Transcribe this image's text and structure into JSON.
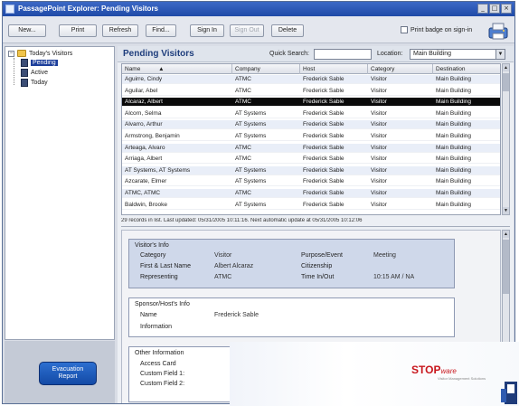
{
  "window": {
    "title": "PassagePoint Explorer: Pending Visitors",
    "controls": [
      "_",
      "□",
      "×"
    ]
  },
  "toolbar": {
    "buttons": [
      "New...",
      "Print",
      "Refresh",
      "Find...",
      "Sign In",
      "Sign Out",
      "Delete"
    ],
    "disabled_index": 5,
    "checkbox_label": "Print badge on sign-in"
  },
  "tree": {
    "root": "Today's Visitors",
    "items": [
      "Pending",
      "Active",
      "Today"
    ],
    "selected": "Pending"
  },
  "evacuation": {
    "line1": "Evacuation",
    "line2": "Report"
  },
  "grid": {
    "title": "Pending Visitors",
    "quick_search_label": "Quick Search:",
    "quick_search_value": "",
    "location_label": "Location:",
    "location_value": "Main Building",
    "columns": [
      "Name",
      "Company",
      "Host",
      "Category",
      "Destination"
    ],
    "sort_indicator": "▲",
    "rows": [
      [
        "Aguirre, Cindy",
        "ATMC",
        "Frederick Sable",
        "Visitor",
        "Main Building"
      ],
      [
        "Aguilar, Abel",
        "ATMC",
        "Frederick Sable",
        "Visitor",
        "Main Building"
      ],
      [
        "Alcaraz, Albert",
        "ATMC",
        "Frederick Sable",
        "Visitor",
        "Main Building"
      ],
      [
        "Alcorn, Selma",
        "AT Systems",
        "Frederick Sable",
        "Visitor",
        "Main Building"
      ],
      [
        "Alvarro, Arthur",
        "AT Systems",
        "Frederick Sable",
        "Visitor",
        "Main Building"
      ],
      [
        "Armstrong, Benjamin",
        "AT Systems",
        "Frederick Sable",
        "Visitor",
        "Main Building"
      ],
      [
        "Arteaga, Alvaro",
        "ATMC",
        "Frederick Sable",
        "Visitor",
        "Main Building"
      ],
      [
        "Arriaga, Albert",
        "ATMC",
        "Frederick Sable",
        "Visitor",
        "Main Building"
      ],
      [
        "AT Systems, AT Systems",
        "AT Systems",
        "Frederick Sable",
        "Visitor",
        "Main Building"
      ],
      [
        "Azcarate, Elmer",
        "AT Systems",
        "Frederick Sable",
        "Visitor",
        "Main Building"
      ],
      [
        "ATMC, ATMC",
        "ATMC",
        "Frederick Sable",
        "Visitor",
        "Main Building"
      ],
      [
        "Baldwin, Brooke",
        "AT Systems",
        "Frederick Sable",
        "Visitor",
        "Main Building"
      ]
    ],
    "selected_row": 2,
    "status": "29 records in list. Last updated: 05/31/2005 10:11:16. Next automatic update at 05/31/2005 10:12:06"
  },
  "visitor_info": {
    "title": "Visitor's Info",
    "fields": [
      {
        "label": "Category",
        "value": "Visitor"
      },
      {
        "label": "First & Last Name",
        "value": "Albert Alcaraz"
      },
      {
        "label": "Representing",
        "value": "ATMC"
      }
    ],
    "fields_right": [
      {
        "label": "Purpose/Event",
        "value": "Meeting"
      },
      {
        "label": "Citizenship",
        "value": ""
      },
      {
        "label": "Time In/Out",
        "value": "10:15 AM / NA"
      }
    ]
  },
  "sponsor_info": {
    "title": "Sponsor/Host's Info",
    "fields": [
      {
        "label": "Name",
        "value": "Frederick Sable"
      },
      {
        "label": "Information",
        "value": ""
      }
    ]
  },
  "other_info": {
    "title": "Other Information",
    "fields": [
      {
        "label": "Access Card",
        "value": ""
      },
      {
        "label": "Custom Field 1:",
        "value": ""
      },
      {
        "label": "Custom Field 2:",
        "value": ""
      }
    ]
  },
  "branding": {
    "logo_stop": "STOP",
    "logo_ware": "ware",
    "tagline": "Visitor Management Solutions",
    "logo_color": "#c8161d"
  },
  "colors": {
    "titlebar": "#2a57b8",
    "selected_row": "#0a0a0a",
    "visitor_box": "#cfd8ea",
    "grid_title": "#1e3d7c"
  }
}
